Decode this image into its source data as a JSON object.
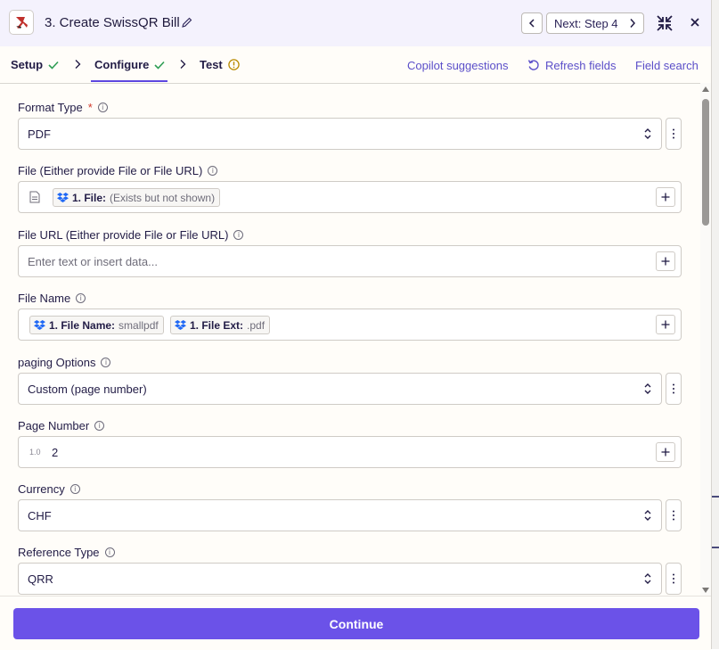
{
  "header": {
    "title": "3. Create SwissQR Bill",
    "next_label": "Next: Step 4"
  },
  "tabs": [
    {
      "label": "Setup",
      "status": "check"
    },
    {
      "label": "Configure",
      "status": "check",
      "active": true
    },
    {
      "label": "Test",
      "status": "warning"
    }
  ],
  "links": {
    "copilot": "Copilot suggestions",
    "refresh": "Refresh fields",
    "field_search": "Field search"
  },
  "fields": {
    "format_type": {
      "label": "Format Type",
      "required": "*",
      "value": "PDF"
    },
    "file": {
      "label": "File (Either provide File or File URL)",
      "pill_name": "1. File:",
      "pill_value": "(Exists but not shown)"
    },
    "file_url": {
      "label": "File URL (Either provide File or File URL)",
      "placeholder": "Enter text or insert data..."
    },
    "file_name": {
      "label": "File Name",
      "pill1_name": "1. File Name:",
      "pill1_value": "smallpdf",
      "pill2_name": "1. File Ext:",
      "pill2_value": ".pdf"
    },
    "paging_options": {
      "label": "paging Options",
      "value": "Custom (page number)"
    },
    "page_number": {
      "label": "Page Number",
      "type_hint": "1.0",
      "value": "2"
    },
    "currency": {
      "label": "Currency",
      "value": "CHF"
    },
    "reference_type": {
      "label": "Reference Type",
      "value": "QRR"
    }
  },
  "footer": {
    "continue_label": "Continue"
  },
  "colors": {
    "accent": "#6b52e8",
    "link": "#5b4fc9",
    "check": "#2f9e55",
    "warning": "#b98a00",
    "dropbox": "#1f68f5"
  }
}
